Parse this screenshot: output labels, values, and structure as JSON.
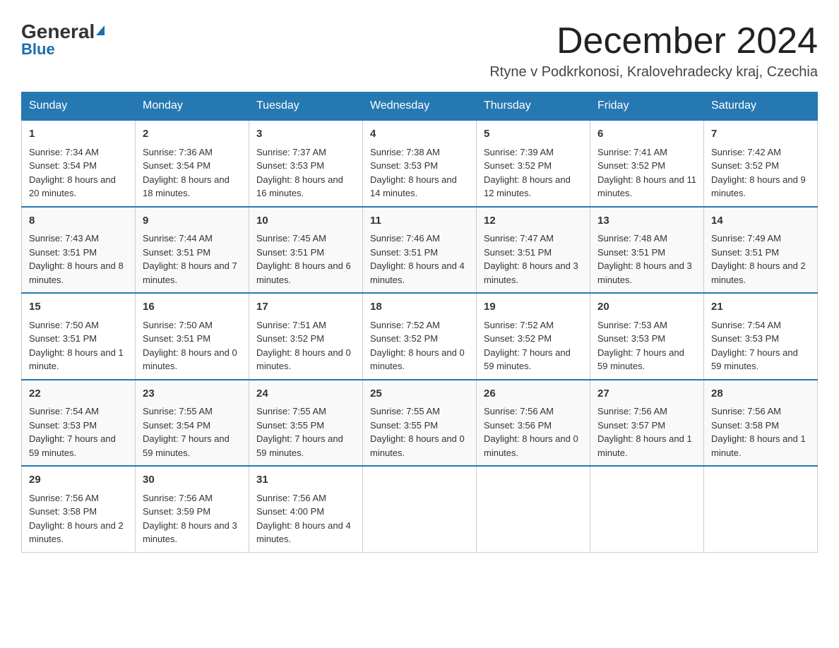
{
  "header": {
    "logo_general": "General",
    "logo_blue": "Blue",
    "month_title": "December 2024",
    "location": "Rtyne v Podkrkonosi, Kralovehradecky kraj, Czechia"
  },
  "weekdays": [
    "Sunday",
    "Monday",
    "Tuesday",
    "Wednesday",
    "Thursday",
    "Friday",
    "Saturday"
  ],
  "weeks": [
    [
      {
        "day": "1",
        "sunrise": "7:34 AM",
        "sunset": "3:54 PM",
        "daylight": "8 hours and 20 minutes."
      },
      {
        "day": "2",
        "sunrise": "7:36 AM",
        "sunset": "3:54 PM",
        "daylight": "8 hours and 18 minutes."
      },
      {
        "day": "3",
        "sunrise": "7:37 AM",
        "sunset": "3:53 PM",
        "daylight": "8 hours and 16 minutes."
      },
      {
        "day": "4",
        "sunrise": "7:38 AM",
        "sunset": "3:53 PM",
        "daylight": "8 hours and 14 minutes."
      },
      {
        "day": "5",
        "sunrise": "7:39 AM",
        "sunset": "3:52 PM",
        "daylight": "8 hours and 12 minutes."
      },
      {
        "day": "6",
        "sunrise": "7:41 AM",
        "sunset": "3:52 PM",
        "daylight": "8 hours and 11 minutes."
      },
      {
        "day": "7",
        "sunrise": "7:42 AM",
        "sunset": "3:52 PM",
        "daylight": "8 hours and 9 minutes."
      }
    ],
    [
      {
        "day": "8",
        "sunrise": "7:43 AM",
        "sunset": "3:51 PM",
        "daylight": "8 hours and 8 minutes."
      },
      {
        "day": "9",
        "sunrise": "7:44 AM",
        "sunset": "3:51 PM",
        "daylight": "8 hours and 7 minutes."
      },
      {
        "day": "10",
        "sunrise": "7:45 AM",
        "sunset": "3:51 PM",
        "daylight": "8 hours and 6 minutes."
      },
      {
        "day": "11",
        "sunrise": "7:46 AM",
        "sunset": "3:51 PM",
        "daylight": "8 hours and 4 minutes."
      },
      {
        "day": "12",
        "sunrise": "7:47 AM",
        "sunset": "3:51 PM",
        "daylight": "8 hours and 3 minutes."
      },
      {
        "day": "13",
        "sunrise": "7:48 AM",
        "sunset": "3:51 PM",
        "daylight": "8 hours and 3 minutes."
      },
      {
        "day": "14",
        "sunrise": "7:49 AM",
        "sunset": "3:51 PM",
        "daylight": "8 hours and 2 minutes."
      }
    ],
    [
      {
        "day": "15",
        "sunrise": "7:50 AM",
        "sunset": "3:51 PM",
        "daylight": "8 hours and 1 minute."
      },
      {
        "day": "16",
        "sunrise": "7:50 AM",
        "sunset": "3:51 PM",
        "daylight": "8 hours and 0 minutes."
      },
      {
        "day": "17",
        "sunrise": "7:51 AM",
        "sunset": "3:52 PM",
        "daylight": "8 hours and 0 minutes."
      },
      {
        "day": "18",
        "sunrise": "7:52 AM",
        "sunset": "3:52 PM",
        "daylight": "8 hours and 0 minutes."
      },
      {
        "day": "19",
        "sunrise": "7:52 AM",
        "sunset": "3:52 PM",
        "daylight": "7 hours and 59 minutes."
      },
      {
        "day": "20",
        "sunrise": "7:53 AM",
        "sunset": "3:53 PM",
        "daylight": "7 hours and 59 minutes."
      },
      {
        "day": "21",
        "sunrise": "7:54 AM",
        "sunset": "3:53 PM",
        "daylight": "7 hours and 59 minutes."
      }
    ],
    [
      {
        "day": "22",
        "sunrise": "7:54 AM",
        "sunset": "3:53 PM",
        "daylight": "7 hours and 59 minutes."
      },
      {
        "day": "23",
        "sunrise": "7:55 AM",
        "sunset": "3:54 PM",
        "daylight": "7 hours and 59 minutes."
      },
      {
        "day": "24",
        "sunrise": "7:55 AM",
        "sunset": "3:55 PM",
        "daylight": "7 hours and 59 minutes."
      },
      {
        "day": "25",
        "sunrise": "7:55 AM",
        "sunset": "3:55 PM",
        "daylight": "8 hours and 0 minutes."
      },
      {
        "day": "26",
        "sunrise": "7:56 AM",
        "sunset": "3:56 PM",
        "daylight": "8 hours and 0 minutes."
      },
      {
        "day": "27",
        "sunrise": "7:56 AM",
        "sunset": "3:57 PM",
        "daylight": "8 hours and 1 minute."
      },
      {
        "day": "28",
        "sunrise": "7:56 AM",
        "sunset": "3:58 PM",
        "daylight": "8 hours and 1 minute."
      }
    ],
    [
      {
        "day": "29",
        "sunrise": "7:56 AM",
        "sunset": "3:58 PM",
        "daylight": "8 hours and 2 minutes."
      },
      {
        "day": "30",
        "sunrise": "7:56 AM",
        "sunset": "3:59 PM",
        "daylight": "8 hours and 3 minutes."
      },
      {
        "day": "31",
        "sunrise": "7:56 AM",
        "sunset": "4:00 PM",
        "daylight": "8 hours and 4 minutes."
      },
      null,
      null,
      null,
      null
    ]
  ]
}
